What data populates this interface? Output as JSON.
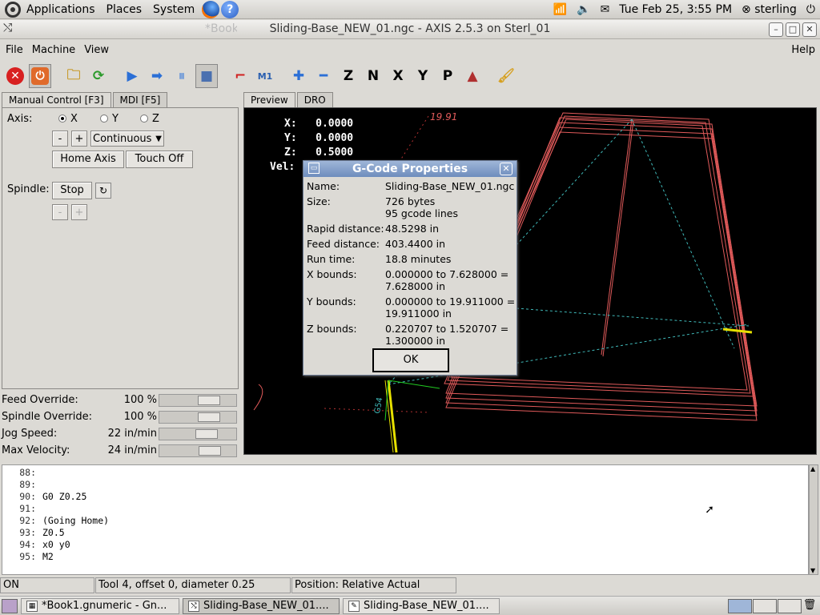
{
  "topbar": {
    "menus": [
      "Applications",
      "Places",
      "System"
    ],
    "clock": "Tue Feb 25,  3:55 PM",
    "user": "sterling"
  },
  "window": {
    "title": "*Book1.gnumeric - Gnumeric",
    "axis_title": "Sliding-Base_NEW_01.ngc - AXIS 2.5.3 on Sterl_01"
  },
  "menubar": {
    "file": "File",
    "machine": "Machine",
    "view": "View",
    "help": "Help"
  },
  "tabs": {
    "manual": "Manual Control [F3]",
    "mdi": "MDI [F5]",
    "preview": "Preview",
    "dro": "DRO"
  },
  "manual": {
    "axis_label": "Axis:",
    "axes": [
      "X",
      "Y",
      "Z"
    ],
    "minus": "-",
    "plus": "+",
    "jog_mode": "Continuous",
    "home_axis": "Home Axis",
    "touch_off": "Touch Off",
    "spindle_label": "Spindle:",
    "stop": "Stop",
    "minus2": "-",
    "plus2": "+"
  },
  "overrides": [
    {
      "label": "Feed Override:",
      "value": "100 %",
      "level": 0.7
    },
    {
      "label": "Spindle Override:",
      "value": "100 %",
      "level": 0.7
    },
    {
      "label": "Jog Speed:",
      "value": "22 in/min",
      "level": 0.66
    },
    {
      "label": "Max Velocity:",
      "value": "24 in/min",
      "level": 0.72
    }
  ],
  "dro": {
    "x_label": "X:",
    "x_value": "0.0000",
    "y_label": "Y:",
    "y_value": "0.0000",
    "z_label": "Z:",
    "z_value": "0.5000",
    "vel_label": "Vel:",
    "dim_label": "19.91",
    "g54": "G54"
  },
  "dialog": {
    "title": "G-Code Properties",
    "rows": [
      {
        "label": "Name:",
        "value": "Sliding-Base_NEW_01.ngc"
      },
      {
        "label": "Size:",
        "value": "726 bytes",
        "value2": "95 gcode lines"
      },
      {
        "label": "Rapid distance:",
        "value": "48.5298 in"
      },
      {
        "label": "Feed distance:",
        "value": "403.4400 in"
      },
      {
        "label": "Run time:",
        "value": "18.8 minutes"
      },
      {
        "label": "X bounds:",
        "value": "0.000000 to 7.628000 =",
        "value2": "7.628000 in"
      },
      {
        "label": "Y bounds:",
        "value": "0.000000 to 19.911000 =",
        "value2": "19.911000 in"
      },
      {
        "label": "Z bounds:",
        "value": "0.220707 to 1.520707 =",
        "value2": "1.300000 in"
      }
    ],
    "ok": "OK"
  },
  "code": [
    {
      "num": "88:",
      "text": ""
    },
    {
      "num": "89:",
      "text": ""
    },
    {
      "num": "90:",
      "text": "G0 Z0.25"
    },
    {
      "num": "91:",
      "text": ""
    },
    {
      "num": "92:",
      "text": "(Going Home)"
    },
    {
      "num": "93:",
      "text": "Z0.5"
    },
    {
      "num": "94:",
      "text": "x0 y0"
    },
    {
      "num": "95:",
      "text": "M2"
    }
  ],
  "status": {
    "state": "ON",
    "tool": "Tool 4, offset 0, diameter 0.25",
    "position": "Position: Relative Actual"
  },
  "taskbar": [
    {
      "label": "*Book1.gnumeric - Gn..."
    },
    {
      "label": "Sliding-Base_NEW_01...."
    },
    {
      "label": "Sliding-Base_NEW_01...."
    }
  ],
  "colors": {
    "toolpath_red": "#e05a5a",
    "toolpath_cyan": "#3fb8b8",
    "tool_yellow": "#e6e000"
  }
}
